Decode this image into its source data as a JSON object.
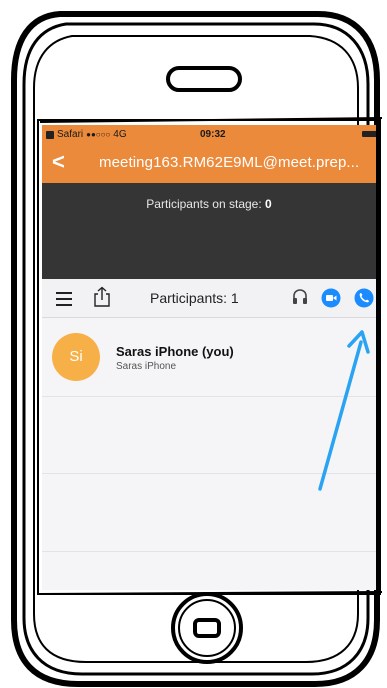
{
  "status_bar": {
    "carrier": "Safari",
    "signal": "●●○○○",
    "network": "4G",
    "time": "09:32"
  },
  "nav": {
    "back_glyph": "<",
    "title": "meeting163.RM62E9ML@meet.prep..."
  },
  "stage": {
    "label": "Participants on stage:",
    "count": "0"
  },
  "toolbar": {
    "title": "Participants: 1",
    "icons": [
      "menu-icon",
      "share-icon",
      "headset-icon",
      "video-icon",
      "call-icon"
    ]
  },
  "participants": [
    {
      "initials": "Si",
      "name": "Saras iPhone (you)",
      "device": "Saras iPhone"
    }
  ],
  "colors": {
    "accent_orange": "#ec8a3c",
    "stage_dark": "#353535",
    "avatar": "#f7b047",
    "call_blue": "#1a8cff",
    "arrow_blue": "#2aa3f2"
  }
}
